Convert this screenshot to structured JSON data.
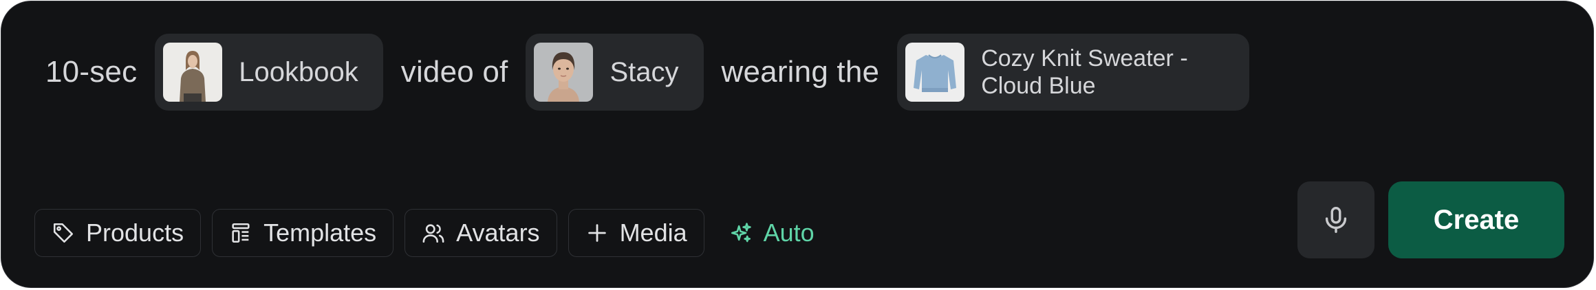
{
  "prompt": {
    "duration": "10-sec",
    "style_chip": {
      "label": "Lookbook",
      "thumb_icon": "lookbook-thumbnail"
    },
    "text_video_of": "video of",
    "avatar_chip": {
      "label": "Stacy",
      "thumb_icon": "avatar-thumbnail"
    },
    "text_wearing": "wearing the",
    "product_chip": {
      "label": "Cozy Knit Sweater - Cloud Blue",
      "thumb_icon": "product-thumbnail"
    }
  },
  "toolbar": {
    "products": {
      "label": "Products",
      "icon": "tag-icon"
    },
    "templates": {
      "label": "Templates",
      "icon": "template-icon"
    },
    "avatars": {
      "label": "Avatars",
      "icon": "users-icon"
    },
    "media": {
      "label": "Media",
      "icon": "plus-icon"
    },
    "auto": {
      "label": "Auto",
      "icon": "sparkles-icon"
    }
  },
  "actions": {
    "mic_icon": "microphone-icon",
    "create_label": "Create"
  },
  "colors": {
    "background": "#121315",
    "chip": "#26282b",
    "text": "#d6d7da",
    "accent_green": "#5fd4a7",
    "create_button": "#0c5c44"
  }
}
